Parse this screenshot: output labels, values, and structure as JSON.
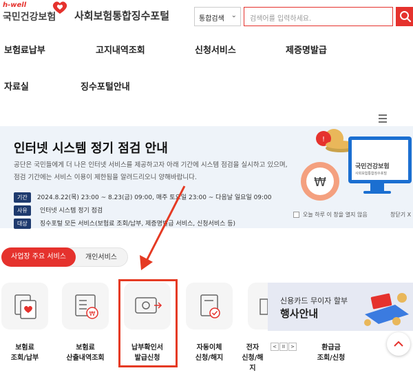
{
  "header": {
    "logo_hwell": "h-well",
    "logo_name": "국민건강보험",
    "portal_title": "사회보험통합징수포털",
    "search_select": "통합검색",
    "search_placeholder": "검색어를 입력하세요."
  },
  "nav": {
    "items": [
      "보험료납부",
      "고지내역조회",
      "신청서비스",
      "제증명발급",
      "자료실",
      "징수포털안내"
    ]
  },
  "banner": {
    "title": "인터넷 시스템 정기 점검 안내",
    "desc1": "공단은 국민들에게 더 나은 인터넷 서비스를 제공하고자 아래 기간에 시스템 점검을 실시하고 있으며,",
    "desc2": "점검 기간에는 서비스 이용이 제한됨을 알려드리오니 양해바랍니다.",
    "rows": [
      {
        "tag": "기간",
        "value": "2024.8.22(목) 23:00 ~ 8.23(금) 09:00, 매주 토요일 23:00 ~ 다음날 일요일 09:00"
      },
      {
        "tag": "사유",
        "value": "인터넷 시스템 정기 점검"
      },
      {
        "tag": "대상",
        "value": "징수포털 모든 서비스(보험료 조회/납부, 제증명발급 서비스, 신청서비스 등)"
      }
    ],
    "no_show_today": "오늘 하루 이 창을 열지 않음",
    "close": "창닫기 X",
    "monitor_logo": "국민건강보험",
    "monitor_sub": "사회보험통합징수포털"
  },
  "tabs": {
    "business": "사업장 주요 서비스",
    "personal": "개인서비스"
  },
  "services": [
    {
      "line1": "보험료",
      "line2": "조회/납부",
      "icon": "heart-document-icon"
    },
    {
      "line1": "보험료",
      "line2": "산출내역조회",
      "icon": "won-list-icon"
    },
    {
      "line1": "납부확인서",
      "line2": "발급신청",
      "icon": "card-arrow-icon"
    },
    {
      "line1": "자동이체",
      "line2": "신청/해지",
      "icon": "document-check-icon"
    },
    {
      "line1": "전자",
      "line2": "신청/해지",
      "icon": "document-icon"
    },
    {
      "line1": "환급금",
      "line2": "조회/신청",
      "icon": "refund-icon"
    }
  ],
  "ad": {
    "line1": "신용카드 무이자 할부",
    "line2": "행사안내"
  },
  "pager": {
    "prev": "<",
    "pause": "II",
    "next": ">"
  },
  "colors": {
    "brand_red": "#e5322d",
    "navy": "#1e3a6e",
    "banner_bg": "#eef3f9"
  }
}
